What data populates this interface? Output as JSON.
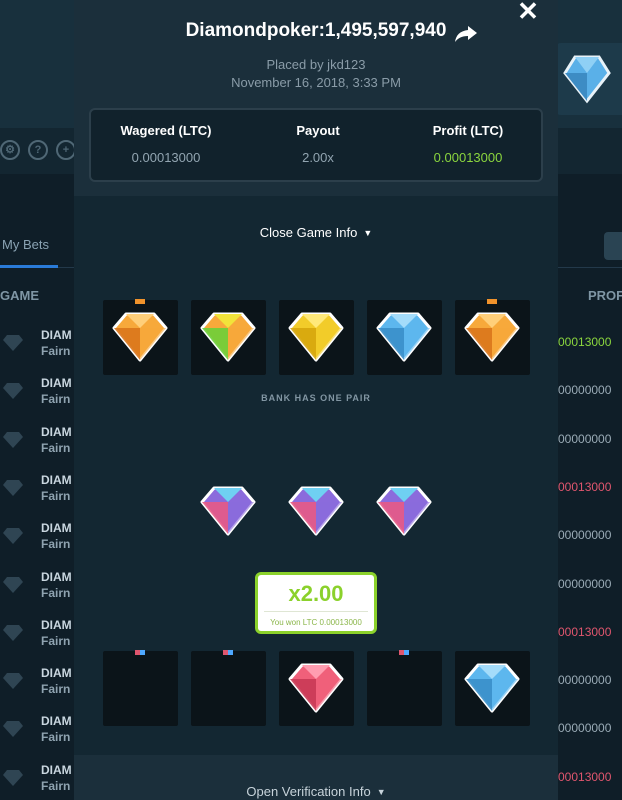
{
  "background": {
    "tab_label": "My Bets",
    "col_game": "GAME",
    "col_profit": "PROF",
    "rows": [
      {
        "name": "DIAM",
        "sub": "Fairn",
        "profit": "00013000",
        "color": "#8bd63e"
      },
      {
        "name": "DIAM",
        "sub": "Fairn",
        "profit": "00000000",
        "color": "#9aabb6"
      },
      {
        "name": "DIAM",
        "sub": "Fairn",
        "profit": "00000000",
        "color": "#9aabb6"
      },
      {
        "name": "DIAM",
        "sub": "Fairn",
        "profit": "00013000",
        "color": "#e0566e"
      },
      {
        "name": "DIAM",
        "sub": "Fairn",
        "profit": "00000000",
        "color": "#9aabb6"
      },
      {
        "name": "DIAM",
        "sub": "Fairn",
        "profit": "00000000",
        "color": "#9aabb6"
      },
      {
        "name": "DIAM",
        "sub": "Fairn",
        "profit": "00013000",
        "color": "#e0566e"
      },
      {
        "name": "DIAM",
        "sub": "Fairn",
        "profit": "00000000",
        "color": "#9aabb6"
      },
      {
        "name": "DIAM",
        "sub": "Fairn",
        "profit": "00000000",
        "color": "#9aabb6"
      },
      {
        "name": "DIAM",
        "sub": "Fairn",
        "profit": "00013000",
        "color": "#e0566e"
      }
    ]
  },
  "modal": {
    "title": "Diamondpoker:1,495,597,940",
    "placed_by": "Placed by jkd123",
    "date": "November 16, 2018, 3:33 PM",
    "close_symbol": "✕",
    "stats": [
      {
        "label": "Wagered (LTC)",
        "value": "0.00013000",
        "color": "#92a5b1"
      },
      {
        "label": "Payout",
        "value": "2.00x",
        "color": "#92a5b1"
      },
      {
        "label": "Profit (LTC)",
        "value": "0.00013000",
        "color": "#8bd63e"
      }
    ],
    "close_info_label": "Close Game Info",
    "bank_label": "BANK HAS ONE PAIR",
    "payout_multiplier": "x2.00",
    "payout_won": "You won LTC 0.00013000",
    "verify_label": "Open Verification Info"
  },
  "colors": {
    "accent_green": "#8bd12b",
    "dealer_marker": "#f0922b",
    "player_marker_a": "#e0566e",
    "player_marker_b": "#4ea8ff"
  },
  "cards": {
    "dealer": [
      {
        "gem": "orange",
        "marker": true
      },
      {
        "gem": "rainbow",
        "marker": false
      },
      {
        "gem": "yellow",
        "marker": false
      },
      {
        "gem": "blue",
        "marker": false
      },
      {
        "gem": "orange",
        "marker": true
      }
    ],
    "player": [
      {
        "gem": "hidden",
        "marker": true
      },
      {
        "gem": "hidden",
        "marker": true
      },
      {
        "gem": "red",
        "marker": false
      },
      {
        "gem": "hidden",
        "marker": true
      },
      {
        "gem": "blue",
        "marker": false
      }
    ],
    "middle": [
      "purple",
      "purple",
      "purple"
    ]
  }
}
